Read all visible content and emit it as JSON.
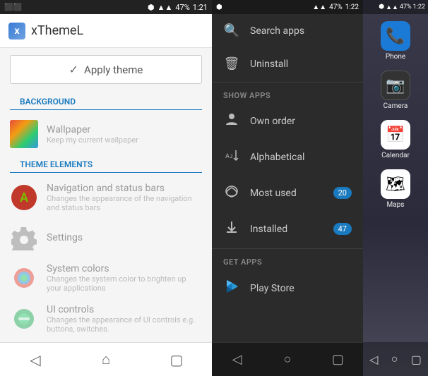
{
  "left": {
    "status_bar": {
      "left": "📶",
      "time": "1:21",
      "battery": "47%"
    },
    "header": {
      "title": "xThemeL"
    },
    "apply_theme_label": "Apply theme",
    "sections": {
      "background_label": "BACKGROUND",
      "wallpaper_title": "Wallpaper",
      "wallpaper_subtitle": "Keep my current wallpaper",
      "theme_elements_label": "THEME ELEMENTS",
      "nav_bars_title": "Navigation and status bars",
      "nav_bars_subtitle": "Changes the appearance of the navigation and status bars",
      "settings_title": "Settings",
      "system_colors_title": "System colors",
      "system_colors_subtitle": "Changes the system color to brighten up your applications",
      "ui_controls_title": "UI controls",
      "ui_controls_subtitle": "Changes the appearance of UI controls e.g. buttons, switches."
    },
    "bottom_nav": {
      "back": "◁",
      "home": "⌂",
      "recents": "▢"
    }
  },
  "drawer": {
    "status_bar": {
      "time": "1:22",
      "battery": "47%"
    },
    "items": [
      {
        "label": "Search apps",
        "icon": "🔍",
        "badge": null
      },
      {
        "label": "Uninstall",
        "icon": "🗑",
        "badge": null
      }
    ],
    "show_apps_label": "SHOW APPS",
    "show_apps_items": [
      {
        "label": "Own order",
        "icon": "👤",
        "badge": null
      },
      {
        "label": "Alphabetical",
        "icon": "↓A",
        "badge": null
      },
      {
        "label": "Most used",
        "icon": "♡",
        "badge": "20"
      },
      {
        "label": "Installed",
        "icon": "⬇",
        "badge": "47"
      }
    ],
    "get_apps_label": "GET APPS",
    "get_apps_items": [
      {
        "label": "Play Store",
        "icon": "▶",
        "badge": null
      }
    ],
    "bottom_nav": {
      "back": "◁",
      "home": "○",
      "recents": "▢"
    }
  },
  "home": {
    "status_bar": {
      "time": "1:22"
    },
    "apps": [
      {
        "label": "Phone",
        "icon": "📞",
        "bg": "phone-icon-bg"
      },
      {
        "label": "Camera",
        "icon": "📷",
        "bg": "camera-icon-bg"
      },
      {
        "label": "Calendar",
        "icon": "📅",
        "bg": "calendar-icon-bg"
      },
      {
        "label": "Maps",
        "icon": "🗺",
        "bg": "maps-icon-bg"
      }
    ]
  }
}
